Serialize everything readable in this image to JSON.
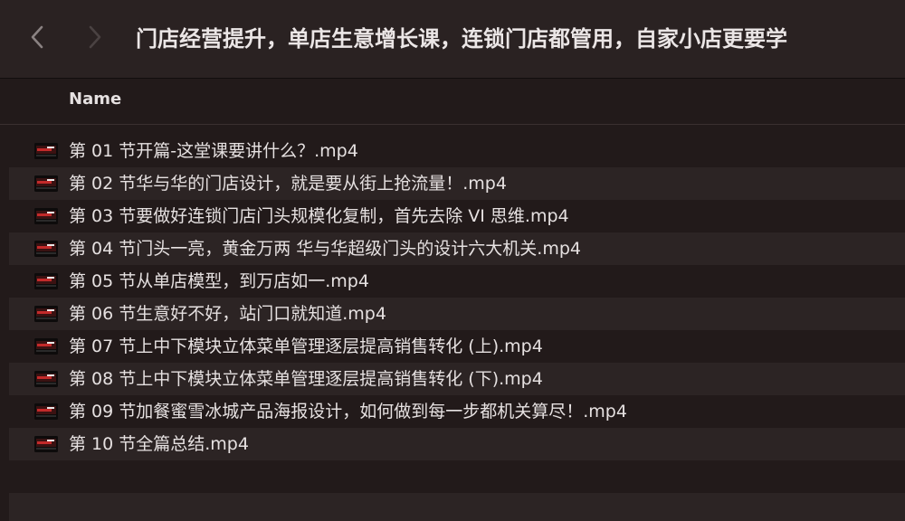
{
  "toolbar": {
    "title": "门店经营提升，单店生意增长课，连锁门店都管用，自家小店更要学",
    "back_icon": "chevron-left-icon",
    "forward_icon": "chevron-right-icon"
  },
  "columns": {
    "name": "Name"
  },
  "files": [
    {
      "name": "第 01 节开篇-这堂课要讲什么？.mp4",
      "icon": "video-file-icon"
    },
    {
      "name": "第 02 节华与华的门店设计，就是要从街上抢流量！.mp4",
      "icon": "video-file-icon"
    },
    {
      "name": "第 03 节要做好连锁门店门头规模化复制，首先去除 VI 思维.mp4",
      "icon": "video-file-icon"
    },
    {
      "name": "第 04 节门头一亮，黄金万两  华与华超级门头的设计六大机关.mp4",
      "icon": "video-file-icon"
    },
    {
      "name": "第 05 节从单店模型，到万店如一.mp4",
      "icon": "video-file-icon"
    },
    {
      "name": "第 06 节生意好不好，站门口就知道.mp4",
      "icon": "video-file-icon"
    },
    {
      "name": "第 07 节上中下模块立体菜单管理逐层提高销售转化 (上).mp4",
      "icon": "video-file-icon"
    },
    {
      "name": "第 08 节上中下模块立体菜单管理逐层提高销售转化 (下).mp4",
      "icon": "video-file-icon"
    },
    {
      "name": "第 09 节加餐蜜雪冰城产品海报设计，如何做到每一步都机关算尽！.mp4",
      "icon": "video-file-icon"
    },
    {
      "name": "第 10 节全篇总结.mp4",
      "icon": "video-file-icon"
    }
  ],
  "colors": {
    "background": "#221a1a",
    "alt_row": "#2c2424",
    "text": "#e6e1e1"
  }
}
